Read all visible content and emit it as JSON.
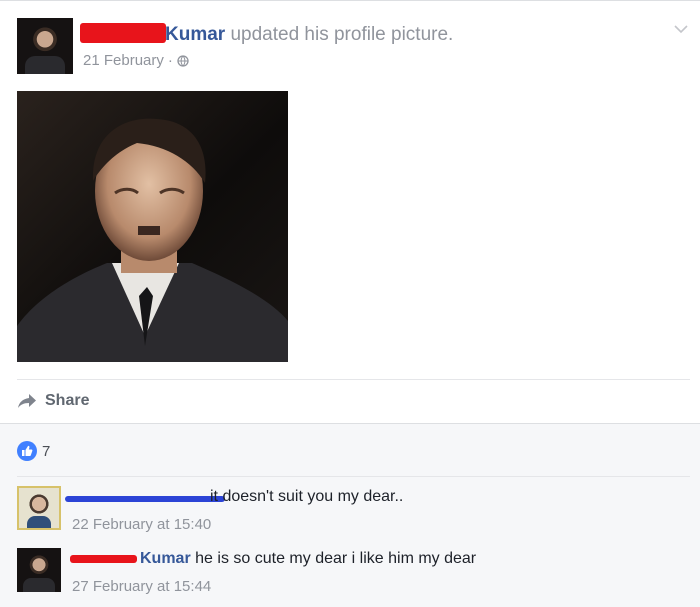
{
  "post": {
    "author_name": "Kumar",
    "action_text": "updated his profile picture.",
    "timestamp": "21 February",
    "separator": "·",
    "privacy_icon": "globe-icon",
    "menu_icon": "chevron-down-icon",
    "share_label": "Share",
    "like_count": "7"
  },
  "comments": [
    {
      "author_name": "",
      "text": "it doesn't suit you my dear..",
      "timestamp": "22 February at 15:40"
    },
    {
      "author_name": "Kumar",
      "text": "he is so cute my dear i like him my dear",
      "timestamp": "27 February at 15:44"
    }
  ],
  "colors": {
    "link": "#365899",
    "muted": "#90949c",
    "like_blue": "#4080ff",
    "redaction_red": "#e8141b",
    "redaction_blue": "#2c44d6",
    "comment_bg": "#f6f7f9"
  }
}
